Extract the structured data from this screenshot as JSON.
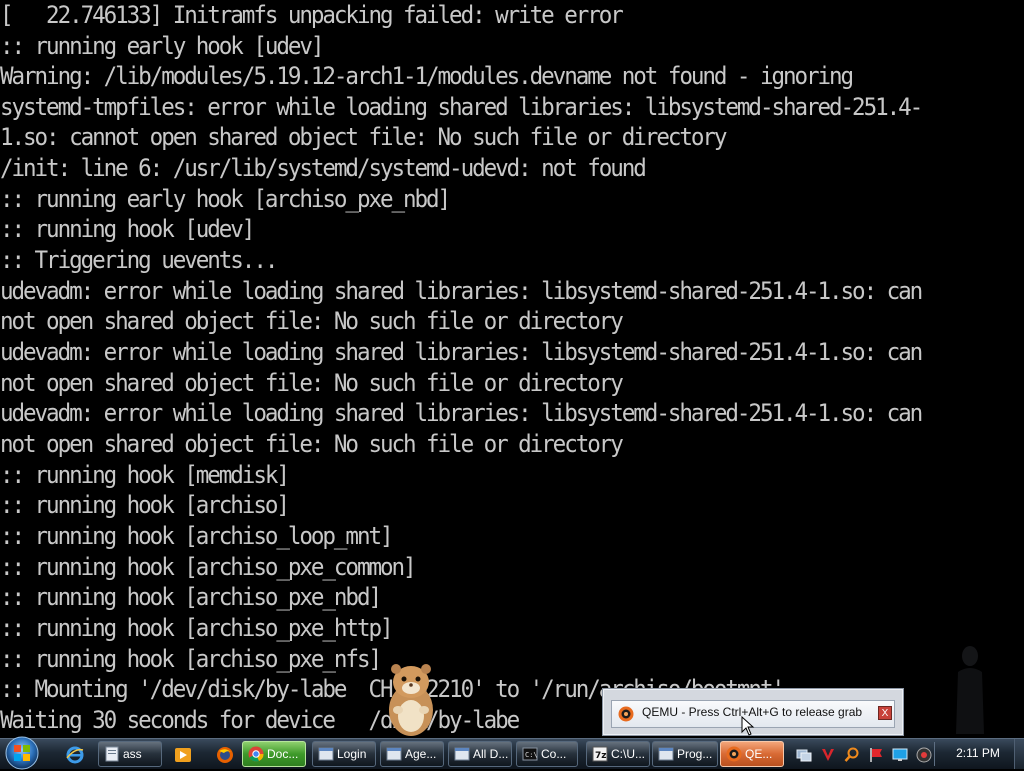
{
  "console": {
    "lines": [
      "[   22.746133] Initramfs unpacking failed: write error",
      ":: running early hook [udev]",
      "Warning: /lib/modules/5.19.12-arch1-1/modules.devname not found - ignoring",
      "systemd-tmpfiles: error while loading shared libraries: libsystemd-shared-251.4-",
      "1.so: cannot open shared object file: No such file or directory",
      "/init: line 6: /usr/lib/systemd/systemd-udevd: not found",
      ":: running early hook [archiso_pxe_nbd]",
      ":: running hook [udev]",
      ":: Triggering uevents...",
      "udevadm: error while loading shared libraries: libsystemd-shared-251.4-1.so: can",
      "not open shared object file: No such file or directory",
      "udevadm: error while loading shared libraries: libsystemd-shared-251.4-1.so: can",
      "not open shared object file: No such file or directory",
      "udevadm: error while loading shared libraries: libsystemd-shared-251.4-1.so: can",
      "not open shared object file: No such file or directory",
      ":: running hook [memdisk]",
      ":: running hook [archiso]",
      ":: running hook [archiso_loop_mnt]",
      ":: running hook [archiso_pxe_common]",
      ":: running hook [archiso_pxe_nbd]",
      ":: running hook [archiso_pxe_http]",
      ":: running hook [archiso_pxe_nfs]",
      ":: Mounting '/dev/disk/by-labe  CH_202210' to '/run/archiso/bootmnt'",
      "Waiting 30 seconds for device   /disk/by-labe"
    ]
  },
  "tooltip": {
    "icon": "qemu-icon",
    "text": "QEMU - Press Ctrl+Alt+G to release grab",
    "close_label": "X"
  },
  "taskbar": {
    "start_icon": "windows-start-orb",
    "quick_launch": [
      "internet-explorer-icon",
      "media-player-icon",
      "firefox-icon"
    ],
    "buttons": [
      {
        "label": "ass",
        "icon": "document-icon"
      },
      {
        "label": "Doc...",
        "icon": "chrome-icon"
      },
      {
        "label": "Login",
        "icon": "window-icon"
      },
      {
        "label": "Age...",
        "icon": "window-icon"
      },
      {
        "label": "All D...",
        "icon": "window-icon"
      },
      {
        "label": "Co...",
        "icon": "console-icon"
      },
      {
        "label": "C:\\U...",
        "icon": "7zip-icon"
      },
      {
        "label": "Prog...",
        "icon": "window-icon"
      },
      {
        "label": "QE...",
        "icon": "qemu-icon"
      }
    ],
    "tray_icons": [
      "network-icon",
      "antivirus-icon",
      "search-icon",
      "flag-icon",
      "display-icon",
      "volume-icon"
    ],
    "clock": "2:11 PM"
  },
  "colors": {
    "console_text": "#c8c8c8",
    "console_bg": "#000000",
    "active_green": "#3e9a2a",
    "active_orange": "#d86a34"
  }
}
